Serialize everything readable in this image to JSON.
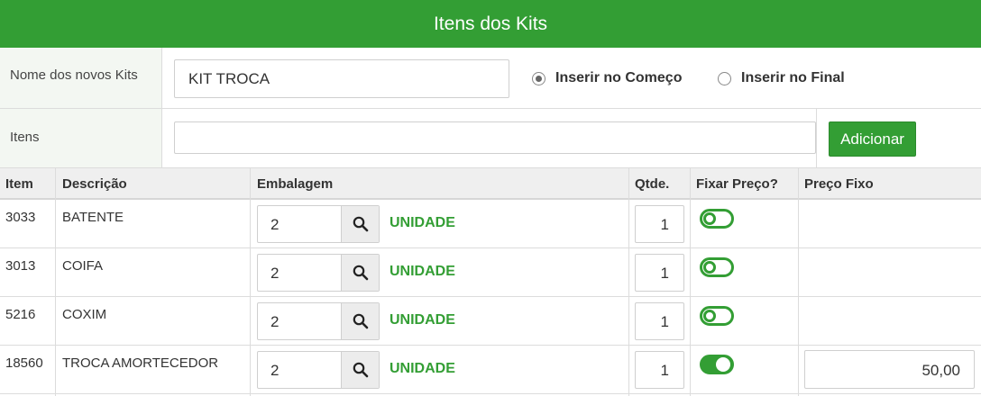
{
  "header": {
    "title": "Itens dos Kits"
  },
  "form": {
    "kit_name_label": "Nome dos novos Kits",
    "kit_name_value": "KIT TROCA",
    "insert_options": [
      {
        "label": "Inserir no Começo",
        "checked": true
      },
      {
        "label": "Inserir no Final",
        "checked": false
      }
    ],
    "itens_label": "Itens",
    "itens_value": "",
    "add_button_label": "Adicionar"
  },
  "table": {
    "columns": [
      "Item",
      "Descrição",
      "Embalagem",
      "Qtde.",
      "Fixar Preço?",
      "Preço Fixo"
    ],
    "rows": [
      {
        "item": "3033",
        "description": "BATENTE",
        "package": "2",
        "unit": "UNIDADE",
        "qty": "1",
        "fix_price": false,
        "fixed_price": ""
      },
      {
        "item": "3013",
        "description": "COIFA",
        "package": "2",
        "unit": "UNIDADE",
        "qty": "1",
        "fix_price": false,
        "fixed_price": ""
      },
      {
        "item": "5216",
        "description": "COXIM",
        "package": "2",
        "unit": "UNIDADE",
        "qty": "1",
        "fix_price": false,
        "fixed_price": ""
      },
      {
        "item": "18560",
        "description": "TROCA AMORTECEDOR",
        "package": "2",
        "unit": "UNIDADE",
        "qty": "1",
        "fix_price": true,
        "fixed_price": "50,00"
      }
    ]
  },
  "colors": {
    "accent": "#339e34",
    "label_bg": "#f3f7f2",
    "header_bg": "#efefef"
  },
  "icons": {
    "search": "search-icon"
  }
}
